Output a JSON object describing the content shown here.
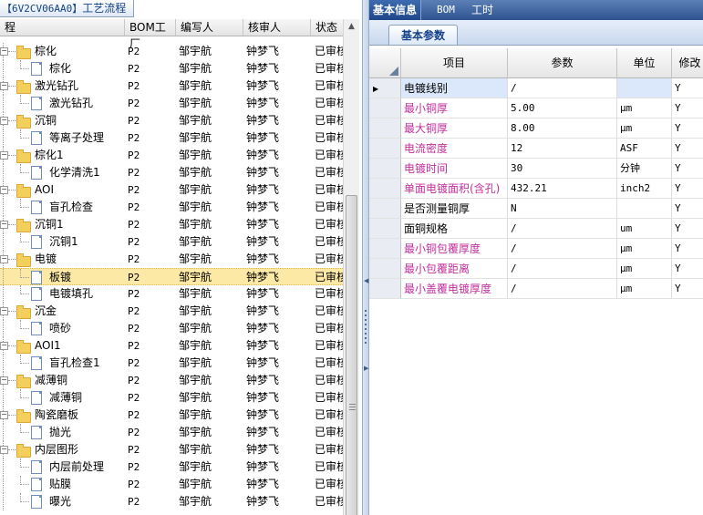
{
  "left_panel": {
    "tab_title_code": "【6V2CV06AA0】",
    "tab_title_text": "工艺流程",
    "columns": [
      {
        "label": "程",
        "key": "name"
      },
      {
        "label": "BOM工厂",
        "key": "bom"
      },
      {
        "label": "编写人",
        "key": "writer"
      },
      {
        "label": "核审人",
        "key": "reviewer"
      },
      {
        "label": "状态",
        "key": "status"
      }
    ],
    "rows": [
      {
        "name": "棕化",
        "level": 0,
        "type": "folder",
        "bom": "P2",
        "writer": "邹宇航",
        "reviewer": "钟梦飞",
        "status": "已审核"
      },
      {
        "name": "棕化",
        "level": 1,
        "type": "doc",
        "bom": "P2",
        "writer": "邹宇航",
        "reviewer": "钟梦飞",
        "status": "已审核"
      },
      {
        "name": "激光钻孔",
        "level": 0,
        "type": "folder",
        "bom": "P2",
        "writer": "邹宇航",
        "reviewer": "钟梦飞",
        "status": "已审核"
      },
      {
        "name": "激光钻孔",
        "level": 1,
        "type": "doc",
        "bom": "P2",
        "writer": "邹宇航",
        "reviewer": "钟梦飞",
        "status": "已审核"
      },
      {
        "name": "沉铜",
        "level": 0,
        "type": "folder",
        "bom": "P2",
        "writer": "邹宇航",
        "reviewer": "钟梦飞",
        "status": "已审核"
      },
      {
        "name": "等离子处理",
        "level": 1,
        "type": "doc",
        "bom": "P2",
        "writer": "邹宇航",
        "reviewer": "钟梦飞",
        "status": "已审核"
      },
      {
        "name": "棕化1",
        "level": 0,
        "type": "folder",
        "bom": "P2",
        "writer": "邹宇航",
        "reviewer": "钟梦飞",
        "status": "已审核"
      },
      {
        "name": "化学清洗1",
        "level": 1,
        "type": "doc",
        "bom": "P2",
        "writer": "邹宇航",
        "reviewer": "钟梦飞",
        "status": "已审核"
      },
      {
        "name": "AOI",
        "level": 0,
        "type": "folder",
        "bom": "P2",
        "writer": "邹宇航",
        "reviewer": "钟梦飞",
        "status": "已审核"
      },
      {
        "name": "盲孔检查",
        "level": 1,
        "type": "doc",
        "bom": "P2",
        "writer": "邹宇航",
        "reviewer": "钟梦飞",
        "status": "已审核"
      },
      {
        "name": "沉铜1",
        "level": 0,
        "type": "folder",
        "bom": "P2",
        "writer": "邹宇航",
        "reviewer": "钟梦飞",
        "status": "已审核"
      },
      {
        "name": "沉铜1",
        "level": 1,
        "type": "doc",
        "bom": "P2",
        "writer": "邹宇航",
        "reviewer": "钟梦飞",
        "status": "已审核"
      },
      {
        "name": "电镀",
        "level": 0,
        "type": "folder",
        "bom": "P2",
        "writer": "邹宇航",
        "reviewer": "钟梦飞",
        "status": "已审核"
      },
      {
        "name": "板镀",
        "level": 1,
        "type": "doc",
        "bom": "P2",
        "writer": "邹宇航",
        "reviewer": "钟梦飞",
        "status": "已审核",
        "selected": true
      },
      {
        "name": "电镀填孔",
        "level": 1,
        "type": "doc",
        "bom": "P2",
        "writer": "邹宇航",
        "reviewer": "钟梦飞",
        "status": "已审核"
      },
      {
        "name": "沉金",
        "level": 0,
        "type": "folder",
        "bom": "P2",
        "writer": "邹宇航",
        "reviewer": "钟梦飞",
        "status": "已审核"
      },
      {
        "name": "喷砂",
        "level": 1,
        "type": "doc",
        "bom": "P2",
        "writer": "邹宇航",
        "reviewer": "钟梦飞",
        "status": "已审核"
      },
      {
        "name": "AOI1",
        "level": 0,
        "type": "folder",
        "bom": "P2",
        "writer": "邹宇航",
        "reviewer": "钟梦飞",
        "status": "已审核"
      },
      {
        "name": "盲孔检查1",
        "level": 1,
        "type": "doc",
        "bom": "P2",
        "writer": "邹宇航",
        "reviewer": "钟梦飞",
        "status": "已审核"
      },
      {
        "name": "减薄铜",
        "level": 0,
        "type": "folder",
        "bom": "P2",
        "writer": "邹宇航",
        "reviewer": "钟梦飞",
        "status": "已审核"
      },
      {
        "name": "减薄铜",
        "level": 1,
        "type": "doc",
        "bom": "P2",
        "writer": "邹宇航",
        "reviewer": "钟梦飞",
        "status": "已审核"
      },
      {
        "name": "陶瓷磨板",
        "level": 0,
        "type": "folder",
        "bom": "P2",
        "writer": "邹宇航",
        "reviewer": "钟梦飞",
        "status": "已审核"
      },
      {
        "name": "抛光",
        "level": 1,
        "type": "doc",
        "bom": "P2",
        "writer": "邹宇航",
        "reviewer": "钟梦飞",
        "status": "已审核"
      },
      {
        "name": "内层图形",
        "level": 0,
        "type": "folder",
        "bom": "P2",
        "writer": "邹宇航",
        "reviewer": "钟梦飞",
        "status": "已审核"
      },
      {
        "name": "内层前处理",
        "level": 1,
        "type": "doc",
        "bom": "P2",
        "writer": "邹宇航",
        "reviewer": "钟梦飞",
        "status": "已审核"
      },
      {
        "name": "贴膜",
        "level": 1,
        "type": "doc",
        "bom": "P2",
        "writer": "邹宇航",
        "reviewer": "钟梦飞",
        "status": "已审核"
      },
      {
        "name": "曝光",
        "level": 1,
        "type": "doc",
        "bom": "P2",
        "writer": "邹宇航",
        "reviewer": "钟梦飞",
        "status": "已审核"
      }
    ]
  },
  "right_panel": {
    "tabs": [
      {
        "label": "基本信息",
        "active": true
      },
      {
        "label": "BOM",
        "active": false
      },
      {
        "label": "工时",
        "active": false
      }
    ],
    "sub_tab": "基本参数",
    "columns": [
      "项目",
      "参数",
      "单位",
      "修改"
    ],
    "rows": [
      {
        "item": "电镀线别",
        "param": "/",
        "unit": "",
        "mod": "Y",
        "highlight": false,
        "current": true
      },
      {
        "item": "最小铜厚",
        "param": "5.00",
        "unit": "μm",
        "mod": "Y",
        "highlight": true
      },
      {
        "item": "最大铜厚",
        "param": "8.00",
        "unit": "μm",
        "mod": "Y",
        "highlight": true
      },
      {
        "item": "电流密度",
        "param": "12",
        "unit": "ASF",
        "mod": "Y",
        "highlight": true
      },
      {
        "item": "电镀时间",
        "param": "30",
        "unit": "分钟",
        "mod": "Y",
        "highlight": true
      },
      {
        "item": "单面电镀面积(含孔)",
        "param": "432.21",
        "unit": "inch2",
        "mod": "Y",
        "highlight": true
      },
      {
        "item": "是否测量铜厚",
        "param": "N",
        "unit": "",
        "mod": "Y",
        "highlight": false
      },
      {
        "item": "面铜规格",
        "param": "/",
        "unit": "um",
        "mod": "Y",
        "highlight": false
      },
      {
        "item": "最小铜包覆厚度",
        "param": "/",
        "unit": "μm",
        "mod": "Y",
        "highlight": true
      },
      {
        "item": "最小包覆距离",
        "param": "/",
        "unit": "μm",
        "mod": "Y",
        "highlight": true
      },
      {
        "item": "最小盖覆电镀厚度",
        "param": "/",
        "unit": "μm",
        "mod": "Y",
        "highlight": true
      }
    ]
  },
  "colors": {
    "highlight_text": "#c12f9c",
    "selected_row": "#fde9a6",
    "current_cell": "#dbe8fb",
    "tab_bar": "#2e5390"
  }
}
